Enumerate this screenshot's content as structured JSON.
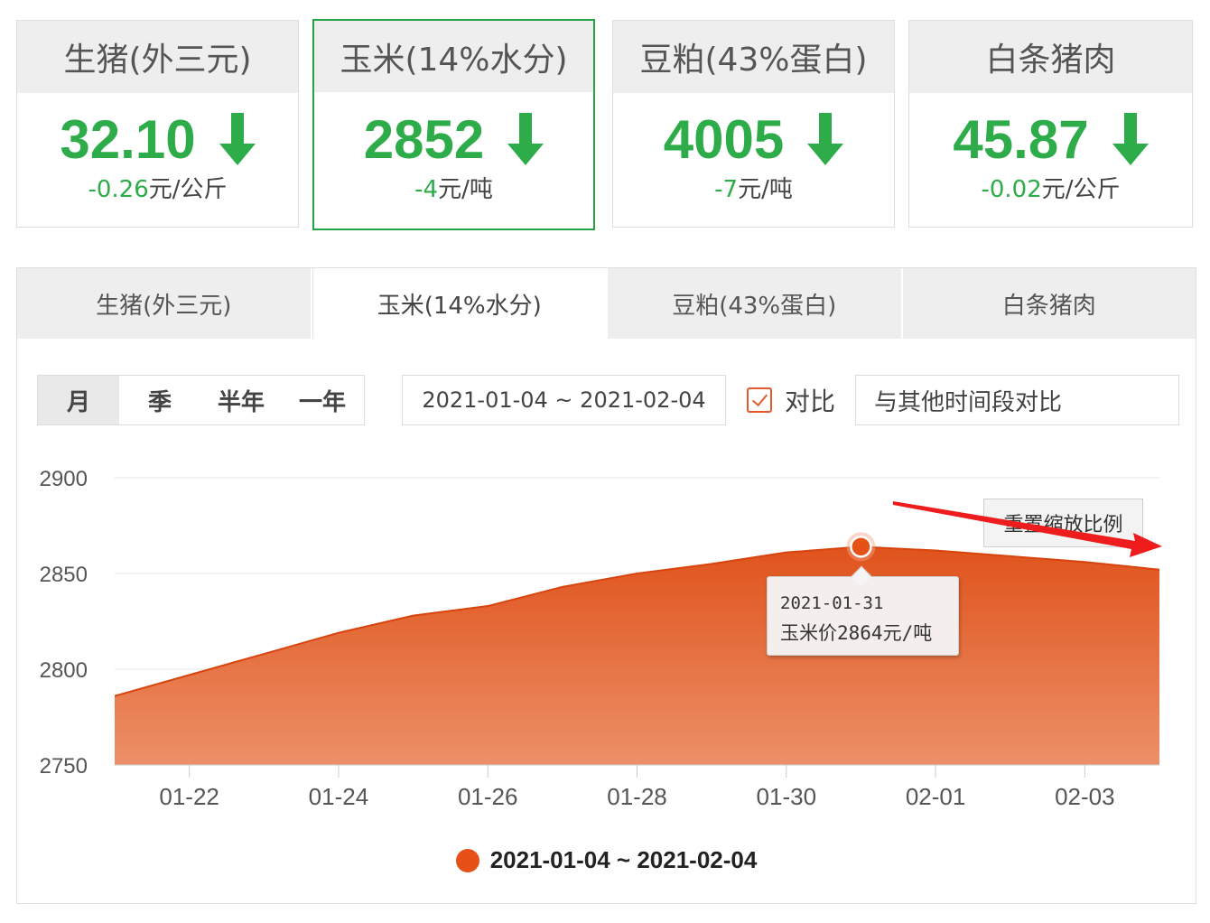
{
  "cards": [
    {
      "title": "生猪(外三元)",
      "price": "32.10",
      "change": "-0.26",
      "unit": "元/公斤",
      "direction": "down",
      "active": false
    },
    {
      "title": "玉米(14%水分)",
      "price": "2852",
      "change": "-4",
      "unit": "元/吨",
      "direction": "down",
      "active": true
    },
    {
      "title": "豆粕(43%蛋白)",
      "price": "4005",
      "change": "-7",
      "unit": "元/吨",
      "direction": "down",
      "active": false
    },
    {
      "title": "白条猪肉",
      "price": "45.87",
      "change": "-0.02",
      "unit": "元/公斤",
      "direction": "down",
      "active": false
    }
  ],
  "tabs": [
    {
      "label": "生猪(外三元)",
      "active": false
    },
    {
      "label": "玉米(14%水分)",
      "active": true
    },
    {
      "label": "豆粕(43%蛋白)",
      "active": false
    },
    {
      "label": "白条猪肉",
      "active": false
    }
  ],
  "periods": [
    {
      "label": "月",
      "active": true
    },
    {
      "label": "季",
      "active": false
    },
    {
      "label": "半年",
      "active": false
    },
    {
      "label": "一年",
      "active": false
    }
  ],
  "date_range": "2021-01-04 ~ 2021-02-04",
  "compare": {
    "label": "对比",
    "checked": true
  },
  "compare_other": "与其他时间段对比",
  "reset_zoom_label": "重置缩放比例",
  "tooltip": {
    "date": "2021-01-31",
    "value_text": "玉米价2864元/吨"
  },
  "legend_label": "2021-01-04 ~ 2021-02-04",
  "colors": {
    "up_down_green": "#2eac4a",
    "series": "#e65117",
    "active_border": "#25a244"
  },
  "chart_data": {
    "type": "area",
    "x": [
      "01-21",
      "01-22",
      "01-23",
      "01-24",
      "01-25",
      "01-26",
      "01-27",
      "01-28",
      "01-29",
      "01-30",
      "01-31",
      "02-01",
      "02-02",
      "02-03",
      "02-04"
    ],
    "series": [
      {
        "name": "2021-01-04 ~ 2021-02-04",
        "values": [
          2786,
          2797,
          2808,
          2819,
          2828,
          2833,
          2843,
          2850,
          2855,
          2861,
          2864,
          2862,
          2859,
          2856,
          2852
        ]
      }
    ],
    "x_tick_labels": [
      "01-22",
      "01-24",
      "01-26",
      "01-28",
      "01-30",
      "02-01",
      "02-03"
    ],
    "y_ticks": [
      2750,
      2800,
      2850,
      2900
    ],
    "ylim": [
      2750,
      2900
    ],
    "grid": true,
    "highlight": {
      "x": "01-31",
      "value": 2864
    },
    "legend_position": "bottom-center"
  }
}
